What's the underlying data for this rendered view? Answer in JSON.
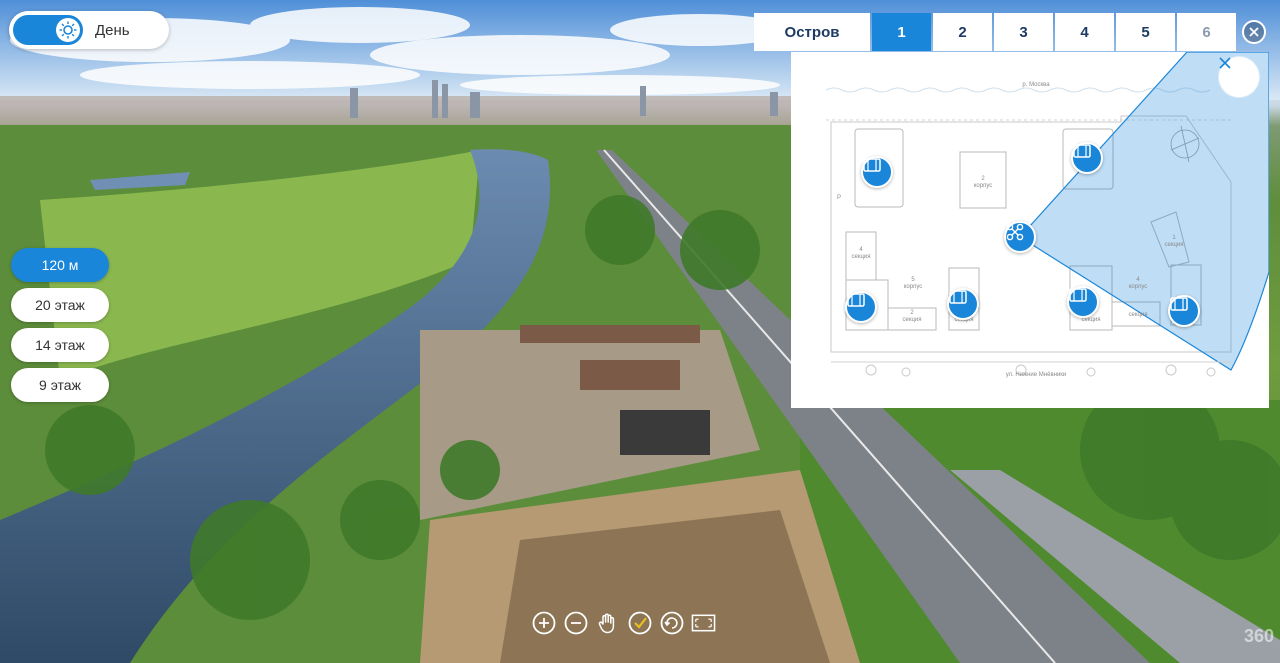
{
  "day_toggle": {
    "label": "День",
    "icon": "sun-icon"
  },
  "heights": [
    {
      "label": "120 м",
      "active": true
    },
    {
      "label": "20 этаж",
      "active": false
    },
    {
      "label": "14 этаж",
      "active": false
    },
    {
      "label": "9 этаж",
      "active": false
    }
  ],
  "tabs": [
    {
      "label": "Остров",
      "active": false
    },
    {
      "label": "1",
      "active": true
    },
    {
      "label": "2",
      "active": false
    },
    {
      "label": "3",
      "active": false
    },
    {
      "label": "4",
      "active": false
    },
    {
      "label": "5",
      "active": false
    },
    {
      "label": "6",
      "active": false
    }
  ],
  "map": {
    "river_label": "р. Москва",
    "street_label": "ул. Нижние Мнёвники",
    "blocks": [
      {
        "label": "2\nкорпус"
      },
      {
        "label": "4\nсекция"
      },
      {
        "label": "5\nкорпус"
      },
      {
        "label": "2\nсекция"
      },
      {
        "label": "3\nсекция"
      },
      {
        "label": "4\nкорпус"
      },
      {
        "label": "1\nсекция"
      },
      {
        "label": "2\nсекция"
      },
      {
        "label": "секция"
      }
    ],
    "parking_label": "P"
  },
  "toolbar": [
    "zoom-in-icon",
    "zoom-out-icon",
    "hand-icon",
    "check-icon",
    "rotate-icon",
    "fullscreen-icon"
  ],
  "watermark": "360",
  "colors": {
    "accent": "#1a86d9",
    "tab_text": "#1d3b63"
  }
}
